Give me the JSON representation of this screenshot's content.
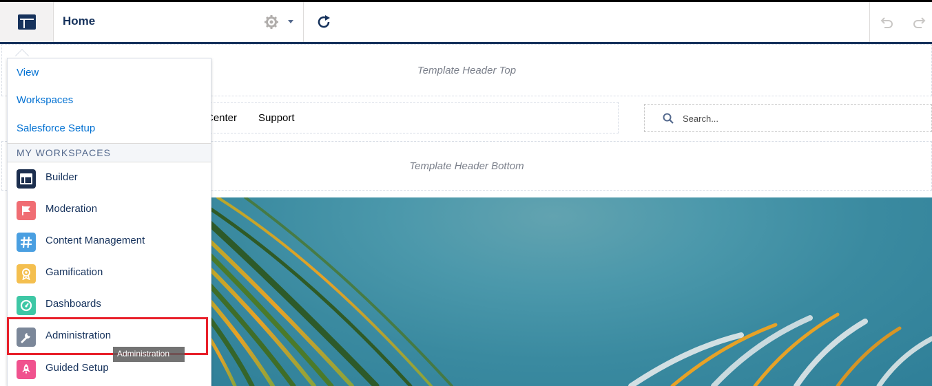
{
  "toolbar": {
    "page_label": "Home",
    "icons": {
      "logo": "builder-icon",
      "gear": "gear-icon",
      "refresh": "refresh-icon",
      "undo": "undo-icon",
      "redo": "redo-icon"
    }
  },
  "canvas": {
    "header_top_label": "Template Header Top",
    "header_bottom_label": "Template Header Bottom",
    "nav_items": [
      "Center",
      "Support"
    ],
    "search_placeholder": "Search..."
  },
  "menu": {
    "links": [
      "View",
      "Workspaces",
      "Salesforce Setup"
    ],
    "section_title": "MY WORKSPACES",
    "workspaces": [
      {
        "label": "Builder",
        "icon": "builder-icon",
        "color": "#1b2e4e"
      },
      {
        "label": "Moderation",
        "icon": "flag-icon",
        "color": "#f06d73"
      },
      {
        "label": "Content Management",
        "icon": "hashtag-icon",
        "color": "#4a9fe1"
      },
      {
        "label": "Gamification",
        "icon": "badge-icon",
        "color": "#f4bf4f"
      },
      {
        "label": "Dashboards",
        "icon": "gauge-icon",
        "color": "#3ec7a5"
      },
      {
        "label": "Administration",
        "icon": "wrench-icon",
        "color": "#7b8799"
      },
      {
        "label": "Guided Setup",
        "icon": "rocket-icon",
        "color": "#f0528e"
      }
    ]
  },
  "tooltip": {
    "text": "Administration"
  },
  "colors": {
    "accent": "#16325c",
    "link": "#0070d2",
    "highlight": "#e8202a"
  }
}
